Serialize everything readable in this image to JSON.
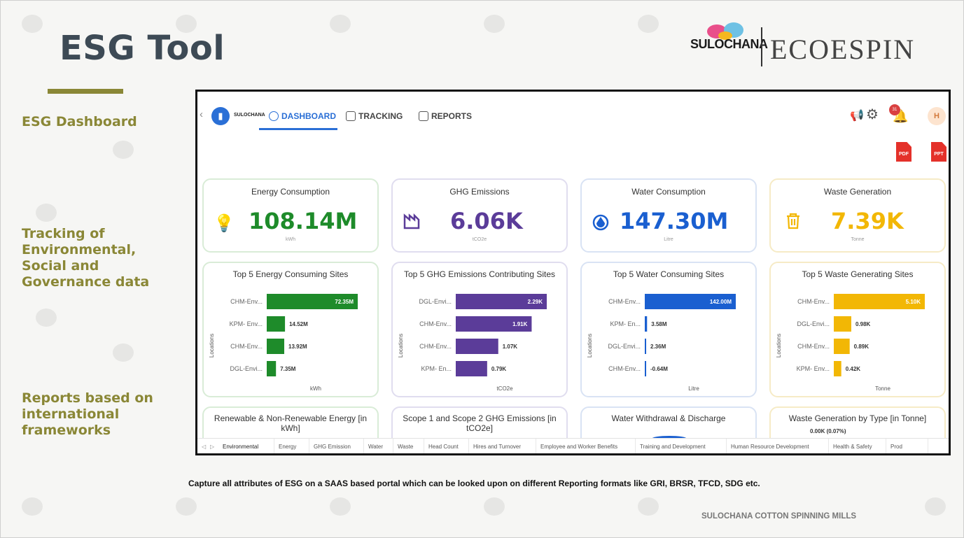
{
  "slide": {
    "title": "ESG Tool",
    "side_labels": [
      "ESG Dashboard",
      "Tracking of Environmental, Social and Governance data",
      "Reports based on international frameworks"
    ],
    "logo_left": "SULOCHANA",
    "logo_right": "ECOESPIN",
    "caption": "Capture all attributes of ESG on a SAAS based portal which can be looked upon on different Reporting formats like GRI, BRSR, TFCD, SDG etc.",
    "footer": "SULOCHANA COTTON SPINNING MILLS"
  },
  "app": {
    "nav": {
      "dashboard": "DASHBOARD",
      "tracking": "TRACKING",
      "reports": "REPORTS",
      "logo_small": "SULOCHANA",
      "bell_count": "31",
      "avatar": "H"
    },
    "downloads": {
      "pdf": "PDF",
      "ppt": "PPT"
    },
    "kpis": [
      {
        "title": "Energy Consumption",
        "value": "108.14M",
        "unit": "kWh",
        "icon": "bulb-icon",
        "color": "#1e8b2a"
      },
      {
        "title": "GHG Emissions",
        "value": "6.06K",
        "unit": "tCO2e",
        "icon": "factory-icon",
        "color": "#5b3c99"
      },
      {
        "title": "Water Consumption",
        "value": "147.30M",
        "unit": "Litre",
        "icon": "drop-icon",
        "color": "#1a5fd0"
      },
      {
        "title": "Waste Generation",
        "value": "7.39K",
        "unit": "Tonne",
        "icon": "trash-icon",
        "color": "#f2b705"
      }
    ],
    "chart_data": [
      {
        "type": "bar",
        "title": "Top 5 Energy Consuming Sites",
        "xlabel": "kWh",
        "ylabel": "Locations",
        "categories": [
          "CHM-Env...",
          "KPM- Env...",
          "CHM-Env...",
          "DGL-Envi..."
        ],
        "values": [
          72.35,
          14.52,
          13.92,
          7.35
        ],
        "labels": [
          "72.35M",
          "14.52M",
          "13.92M",
          "7.35M"
        ],
        "color": "#1e8b2a"
      },
      {
        "type": "bar",
        "title": "Top 5 GHG Emissions Contributing Sites",
        "xlabel": "tCO2e",
        "ylabel": "Locations",
        "categories": [
          "DGL-Envi...",
          "CHM-Env...",
          "CHM-Env...",
          "KPM- En..."
        ],
        "values": [
          2.29,
          1.91,
          1.07,
          0.79
        ],
        "labels": [
          "2.29K",
          "1.91K",
          "1.07K",
          "0.79K"
        ],
        "color": "#5b3c99"
      },
      {
        "type": "bar",
        "title": "Top 5 Water Consuming Sites",
        "xlabel": "Litre",
        "ylabel": "Locations",
        "categories": [
          "CHM-Env...",
          "KPM- En...",
          "DGL-Envi...",
          "CHM-Env..."
        ],
        "values": [
          142.0,
          3.58,
          2.36,
          -0.64
        ],
        "labels": [
          "142.00M",
          "3.58M",
          "2.36M",
          "-0.64M"
        ],
        "color": "#1a5fd0"
      },
      {
        "type": "bar",
        "title": "Top 5 Waste Generating Sites",
        "xlabel": "Tonne",
        "ylabel": "Locations",
        "categories": [
          "CHM-Env...",
          "DGL-Envi...",
          "CHM-Env...",
          "KPM- Env..."
        ],
        "values": [
          5.1,
          0.98,
          0.89,
          0.42
        ],
        "labels": [
          "5.10K",
          "0.98K",
          "0.89K",
          "0.42K"
        ],
        "color": "#f2b705"
      }
    ],
    "bottom_cards": [
      "Renewable & Non-Renewable Energy [in kWh]",
      "Scope 1 and Scope 2 GHG Emissions [in tCO2e]",
      "Water Withdrawal & Discharge",
      "Waste Generation by Type [in Tonne]"
    ],
    "waste_type_label": "0.00K (0.07%)",
    "tabs": [
      "Environmental",
      "Energy",
      "GHG Emission",
      "Water",
      "Waste",
      "Head Count",
      "Hires and Turnover",
      "Employee and Worker Benefits",
      "Training and Development",
      "Human Resource Development",
      "Health & Safety",
      "Prod"
    ]
  }
}
